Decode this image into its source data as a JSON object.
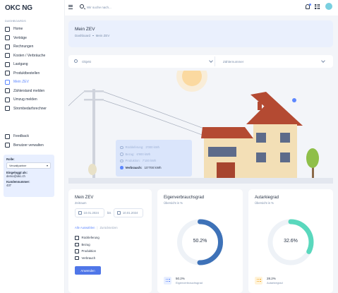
{
  "brand": "OKC NG",
  "sidebar": {
    "section_label": "DASHBOARDS",
    "items": [
      {
        "label": "Home",
        "active": false
      },
      {
        "label": "Verträge",
        "active": false
      },
      {
        "label": "Rechnungen",
        "active": false
      },
      {
        "label": "Kosten / Verbräuche",
        "active": false
      },
      {
        "label": "Lastgang",
        "active": false
      },
      {
        "label": "Produktbestellen",
        "active": false
      },
      {
        "label": "Mein ZEV",
        "active": true
      },
      {
        "label": "Zählerstand melden",
        "active": false
      },
      {
        "label": "Umzug melden",
        "active": false
      },
      {
        "label": "Strombedarfsrechner",
        "active": false
      }
    ],
    "secondary_items": [
      {
        "label": "Feedback"
      },
      {
        "label": "Benutzer verwalten"
      }
    ],
    "role": {
      "label": "Rolle:",
      "value": "Verwaltpartner",
      "logged_in_label": "Eingeloggt als:",
      "logged_in_value": "demo@okc.ch",
      "customer_label": "Kundennummer:",
      "customer_value": "437"
    }
  },
  "topbar": {
    "search_placeholder": "Wir suche nach..."
  },
  "header": {
    "title": "Mein ZEV",
    "breadcrumb": [
      "Dashboard",
      "Mein ZEV"
    ]
  },
  "filters": {
    "object_placeholder": "Objekt",
    "meter_placeholder": "Zählernummer"
  },
  "house_info": {
    "rows": [
      {
        "label": "Rückleferung:",
        "value": "2'000 kWh"
      },
      {
        "label": "Bezug:",
        "value": "6'900 kWh"
      },
      {
        "label": "Produktion:",
        "value": "7'100 kWh"
      },
      {
        "label": "Verbrauch:",
        "value": "10'700 kWh"
      }
    ]
  },
  "zev_card": {
    "title": "Mein ZEV",
    "period_label": "Zeitraum",
    "date_from": "10.01.2024",
    "between": "bis",
    "date_to": "10.01.2024",
    "select_all": "Alle Auswählen",
    "reset": "Zurücksetzen",
    "options": [
      "Rückleferung",
      "Bezug",
      "Produktion",
      "Verbrauch"
    ],
    "apply": "Anwenden"
  },
  "eigen_card": {
    "title": "Eigenverbrauchsgrad",
    "subtitle": "Übersicht in %",
    "value": "50.2%",
    "percent": 50.2,
    "legend_value": "50.2%",
    "legend_label": "Eigenverbrauchsgrad",
    "color": "#3e72b8"
  },
  "autarkie_card": {
    "title": "Autarkiegrad",
    "subtitle": "Übersicht in %",
    "value": "32.6%",
    "percent": 32.6,
    "legend_value": "28.2%",
    "legend_label": "Autarkiegrad",
    "color": "#5ad8bd"
  },
  "colors": {
    "accent": "#5d87ff",
    "header_bg": "#eaf0fd",
    "sidebar_role_bg": "#e8efff"
  }
}
